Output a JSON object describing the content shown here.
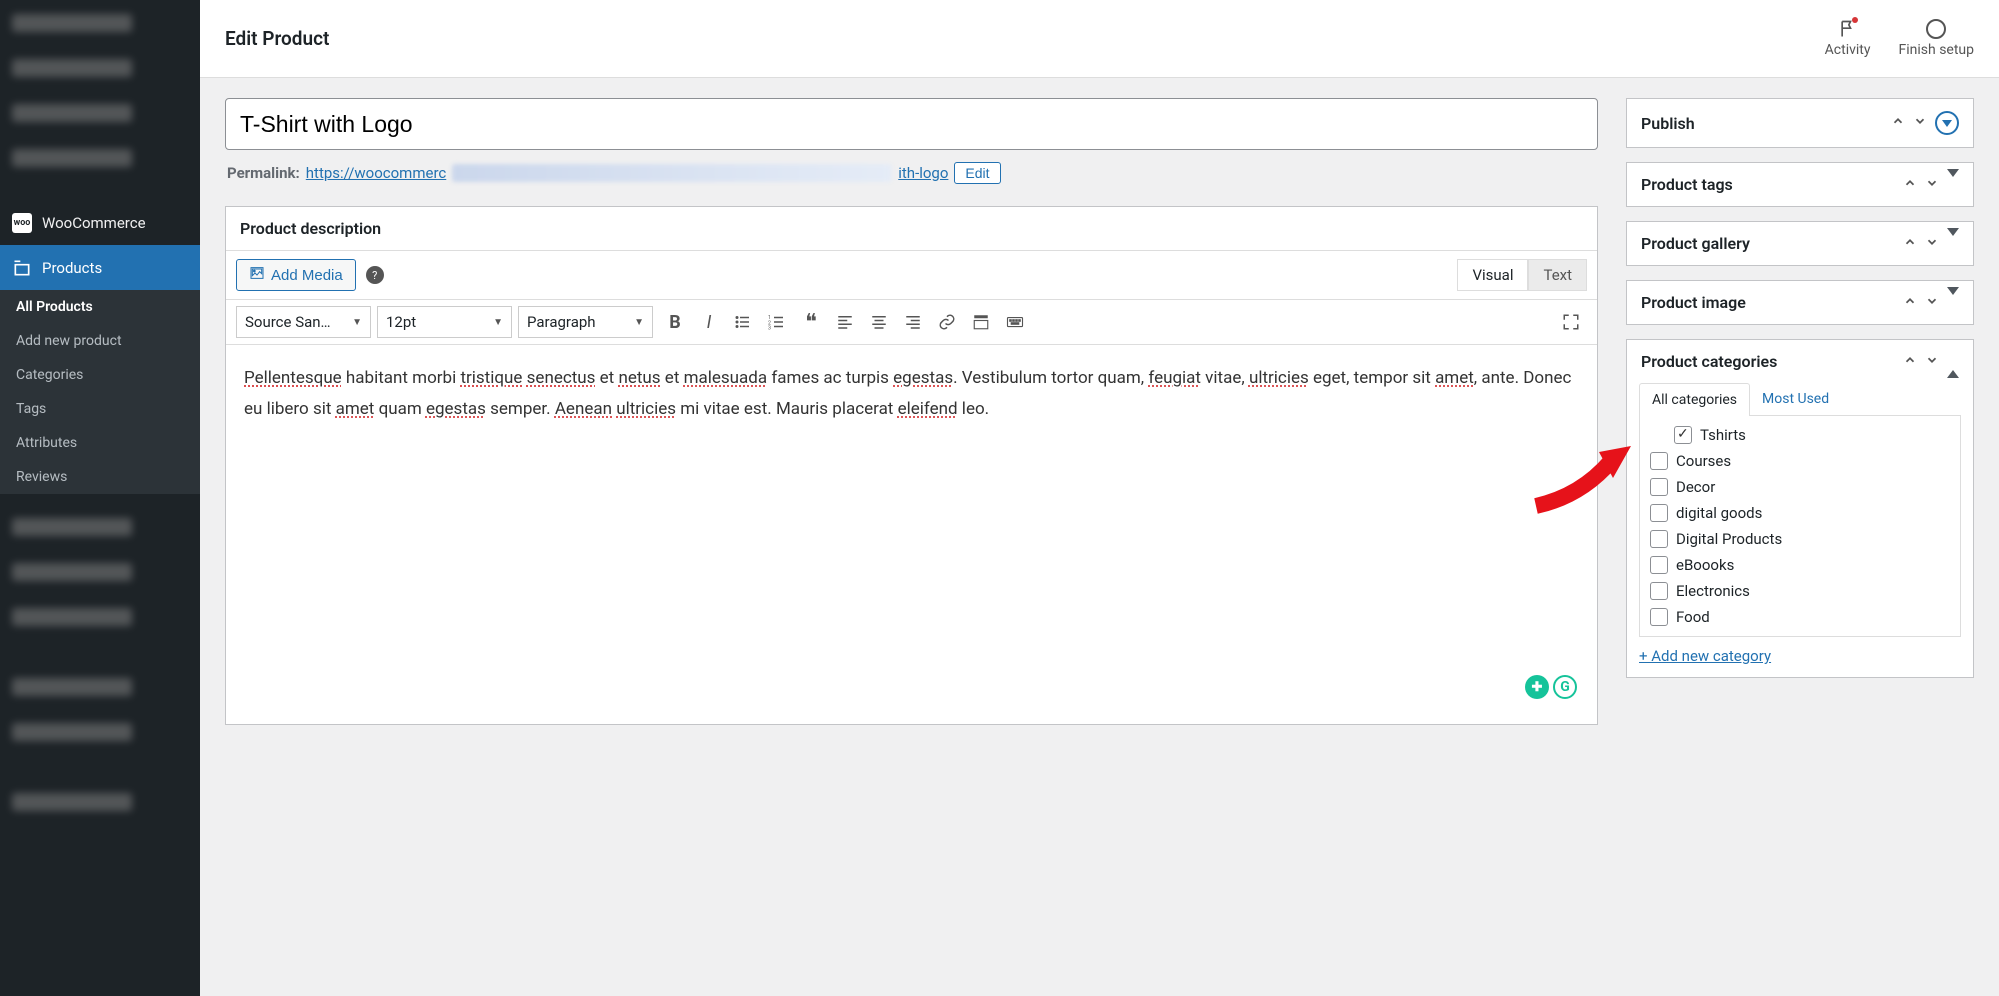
{
  "header": {
    "title": "Edit Product",
    "activity": "Activity",
    "finish_setup": "Finish setup"
  },
  "sidebar": {
    "woo_label": "WooCommerce",
    "products_label": "Products",
    "submenu": [
      "All Products",
      "Add new product",
      "Categories",
      "Tags",
      "Attributes",
      "Reviews"
    ]
  },
  "product": {
    "title": "T-Shirt with Logo",
    "permalink_label": "Permalink:",
    "permalink_prefix": "https://woocommerc",
    "permalink_suffix": "ith-logo",
    "edit_label": "Edit"
  },
  "description_panel": {
    "title": "Product description",
    "add_media": "Add Media",
    "tab_visual": "Visual",
    "tab_text": "Text",
    "font_family": "Source San…",
    "font_size": "12pt",
    "block_format": "Paragraph",
    "body": "Pellentesque habitant morbi tristique senectus et netus et malesuada fames ac turpis egestas. Vestibulum tortor quam, feugiat vitae, ultricies eget, tempor sit amet, ante. Donec eu libero sit amet quam egestas semper. Aenean ultricies mi vitae est. Mauris placerat eleifend leo."
  },
  "side_panels": {
    "publish": "Publish",
    "product_tags": "Product tags",
    "product_gallery": "Product gallery",
    "product_image": "Product image",
    "product_categories": "Product categories"
  },
  "categories": {
    "tab_all": "All categories",
    "tab_most_used": "Most Used",
    "items": [
      {
        "label": "Tshirts",
        "checked": true,
        "indent": true
      },
      {
        "label": "Courses",
        "checked": false,
        "indent": false
      },
      {
        "label": "Decor",
        "checked": false,
        "indent": false
      },
      {
        "label": "digital goods",
        "checked": false,
        "indent": false
      },
      {
        "label": "Digital Products",
        "checked": false,
        "indent": false
      },
      {
        "label": "eBoooks",
        "checked": false,
        "indent": false
      },
      {
        "label": "Electronics",
        "checked": false,
        "indent": false
      },
      {
        "label": "Food",
        "checked": false,
        "indent": false
      }
    ],
    "add_new": "+ Add new category"
  }
}
